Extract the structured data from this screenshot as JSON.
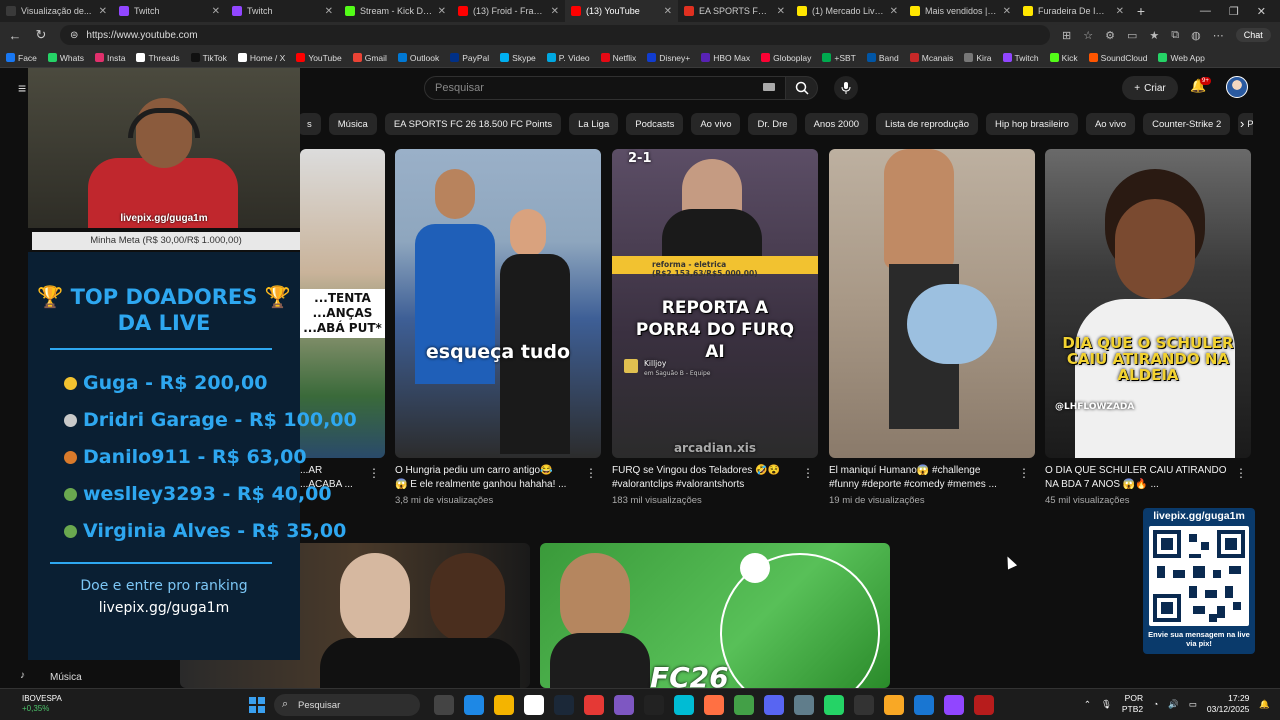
{
  "browser": {
    "tabs": [
      {
        "title": "Visualização de...",
        "color": "#3a3a3a",
        "active": false
      },
      {
        "title": "Twitch",
        "color": "#9146ff",
        "active": false
      },
      {
        "title": "Twitch",
        "color": "#9146ff",
        "active": false
      },
      {
        "title": "Stream - Kick Dashb...",
        "color": "#53fc18",
        "active": false
      },
      {
        "title": "(13) Froid - Fran's C...",
        "color": "#ff0000",
        "active": false
      },
      {
        "title": "(13) YouTube",
        "color": "#ff0000",
        "active": true
      },
      {
        "title": "EA SPORTS FC 26 Ev...",
        "color": "#e03020",
        "active": false
      },
      {
        "title": "(1) Mercado Livre Br...",
        "color": "#ffe600",
        "active": false
      },
      {
        "title": "Mais vendidos | Mer...",
        "color": "#ffe600",
        "active": false
      },
      {
        "title": "Furadeira De Impact...",
        "color": "#ffe600",
        "active": false
      }
    ],
    "url": "https://www.youtube.com",
    "chat_label": "Chat",
    "bookmarks": [
      {
        "label": "Face",
        "color": "#1877f2"
      },
      {
        "label": "Whats",
        "color": "#25d366"
      },
      {
        "label": "Insta",
        "color": "#e1306c"
      },
      {
        "label": "Threads",
        "color": "#ffffff"
      },
      {
        "label": "TikTok",
        "color": "#111111"
      },
      {
        "label": "Home / X",
        "color": "#ffffff"
      },
      {
        "label": "YouTube",
        "color": "#ff0000"
      },
      {
        "label": "Gmail",
        "color": "#ea4335"
      },
      {
        "label": "Outlook",
        "color": "#0078d4"
      },
      {
        "label": "PayPal",
        "color": "#003087"
      },
      {
        "label": "Skype",
        "color": "#00aff0"
      },
      {
        "label": "P. Video",
        "color": "#00a8e1"
      },
      {
        "label": "Netflix",
        "color": "#e50914"
      },
      {
        "label": "Disney+",
        "color": "#113ccf"
      },
      {
        "label": "HBO Max",
        "color": "#5822b4"
      },
      {
        "label": "Globoplay",
        "color": "#fb0234"
      },
      {
        "label": "+SBT",
        "color": "#00aa4f"
      },
      {
        "label": "Band",
        "color": "#0055a5"
      },
      {
        "label": "Mcanais",
        "color": "#c62828"
      },
      {
        "label": "Kira",
        "color": "#777777"
      },
      {
        "label": "Twitch",
        "color": "#9146ff"
      },
      {
        "label": "Kick",
        "color": "#53fc18"
      },
      {
        "label": "SoundCloud",
        "color": "#ff5500"
      },
      {
        "label": "Web App",
        "color": "#25d366"
      }
    ]
  },
  "youtube": {
    "search_placeholder": "Pesquisar",
    "create_label": "Criar",
    "notifications_badge": "9+",
    "chips": [
      "s",
      "Música",
      "EA SPORTS FC 26 18.500 FC Points",
      "La Liga",
      "Podcasts",
      "Ao vivo",
      "Dr. Dre",
      "Anos 2000",
      "Lista de reprodução",
      "Hip hop brasileiro",
      "Ao vivo",
      "Counter-Strike 2",
      "PC Games"
    ],
    "videos": [
      {
        "title_l1": "...AR",
        "title_l2": "...ACABA ...",
        "views": "",
        "overlay": "...TENTA ...ANÇAS ...ABÁ PUT*",
        "bg": "#6a4a3a"
      },
      {
        "title_l1": "O Hungria pediu um carro antigo😂",
        "title_l2": "😱 E ele realmente ganhou hahaha! ...",
        "views": "3,8 mi de visualizações",
        "overlay": "esqueça tudo",
        "bg": "#7a8a9a"
      },
      {
        "title_l1": "FURQ se Vingou dos Teladores 🤣😵",
        "title_l2": "#valorantclips #valorantshorts",
        "views": "183 mil visualizações",
        "overlay": "REPORTA A PORR4 DO FURQ AI",
        "bg": "#4a3a5a"
      },
      {
        "title_l1": "El maniquí Humano😱 #challenge",
        "title_l2": "#funny #deporte #comedy #memes ...",
        "views": "19 mi de visualizações",
        "overlay": "",
        "bg": "#8a7a6a"
      },
      {
        "title_l1": "O DIA QUE SCHULER CAIU ATIRANDO",
        "title_l2": "NA BDA 7 ANOS 😱🔥 ...",
        "views": "45 mil visualizações",
        "overlay": "DIA QUE O SCHULER CAIU ATIRANDO NA ALDEIA",
        "bg": "#2a2a2a"
      }
    ],
    "thumb_extra": {
      "valorant_score": "2-1",
      "valorant_goal": "reforma - eletrica (R$2.153,63/R$5.000,00)",
      "valorant_name": "Killjoy",
      "valorant_sub": "em Saguão B - Equipe",
      "valorant_credit": "arcadian.xis",
      "schuler_credit": "@LHFLOWZADA",
      "fc26_text": "FC26"
    },
    "sidebar": {
      "musica": "Música"
    }
  },
  "stream_overlay": {
    "cam_label": "livepix.gg/guga1m",
    "goal_label": "Minha Meta (R$ 30,00/R$ 1.000,00)",
    "donors_title_l1": "🏆 TOP DOADORES 🏆",
    "donors_title_l2": "DA LIVE",
    "donors": [
      {
        "text": "Guga - R$ 200,00",
        "medal": "#f2c230"
      },
      {
        "text": "Dridri Garage - R$ 100,00",
        "medal": "#c9c9c9"
      },
      {
        "text": "Danilo911 - R$ 63,00",
        "medal": "#d97a2b"
      },
      {
        "text": "weslley3293 - R$ 40,00",
        "medal": "#6aa84f"
      },
      {
        "text": "Virginia Alves - R$ 35,00",
        "medal": "#6aa84f"
      }
    ],
    "cta": "Doe e entre pro ranking",
    "cta_url": "livepix.gg/guga1m",
    "qr_top": "livepix.gg/guga1m",
    "qr_footer": "Envie sua mensagem na live via pix!"
  },
  "taskbar": {
    "stock_name": "IBOVESPA",
    "stock_change": "+0,35%",
    "search_label": "Pesquisar",
    "lang_l1": "POR",
    "lang_l2": "PTB2",
    "time": "17:29",
    "date": "03/12/2025",
    "app_colors": [
      "#444444",
      "#1e88e5",
      "#f4b400",
      "#ffffff",
      "#1b2838",
      "#e53935",
      "#7e57c2",
      "#222222",
      "#00bcd4",
      "#ff7043",
      "#43a047",
      "#5865f2",
      "#607d8b",
      "#25d366",
      "#333333",
      "#f9a825",
      "#1976d2",
      "#9146ff",
      "#b71c1c"
    ]
  }
}
